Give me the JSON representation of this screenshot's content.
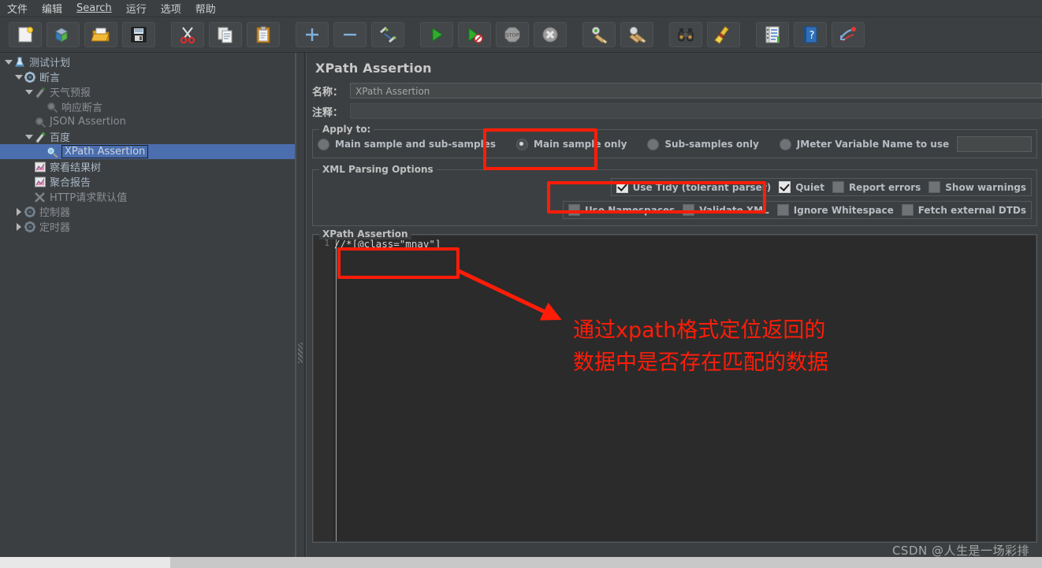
{
  "window": {
    "app": "Apache JMeter"
  },
  "menubar": {
    "items": [
      {
        "label": "文件",
        "underlined": false
      },
      {
        "label": "编辑",
        "underlined": false
      },
      {
        "label": "Search",
        "underlined": true
      },
      {
        "label": "运行",
        "underlined": false
      },
      {
        "label": "选项",
        "underlined": false
      },
      {
        "label": "帮助",
        "underlined": false
      }
    ]
  },
  "toolbar": {
    "buttons": [
      {
        "name": "new-icon",
        "tip": "新建"
      },
      {
        "name": "templates-icon",
        "tip": "模板"
      },
      {
        "name": "open-icon",
        "tip": "打开"
      },
      {
        "name": "save-icon",
        "tip": "保存"
      },
      {
        "name": "cut-icon",
        "tip": "剪切"
      },
      {
        "name": "copy-icon",
        "tip": "复制"
      },
      {
        "name": "paste-icon",
        "tip": "粘贴"
      },
      {
        "name": "expand-all-icon",
        "tip": "展开"
      },
      {
        "name": "collapse-all-icon",
        "tip": "折叠"
      },
      {
        "name": "toggle-icon",
        "tip": "启用/禁用"
      },
      {
        "name": "start-icon",
        "tip": "启动"
      },
      {
        "name": "start-no-pause-icon",
        "tip": "无超时启动"
      },
      {
        "name": "stop-icon",
        "tip": "停止"
      },
      {
        "name": "shutdown-icon",
        "tip": "关闭"
      },
      {
        "name": "clear-icon",
        "tip": "清除"
      },
      {
        "name": "clear-all-icon",
        "tip": "清除全部"
      },
      {
        "name": "search-binoculars-icon",
        "tip": "查找"
      },
      {
        "name": "reset-search-icon",
        "tip": "重置查找"
      },
      {
        "name": "function-helper-icon",
        "tip": "函数助手"
      },
      {
        "name": "help-icon",
        "tip": "帮助"
      },
      {
        "name": "undo-redo-icon",
        "tip": "撤销"
      }
    ]
  },
  "tree": {
    "nodes": [
      {
        "label": "测试计划",
        "indent": 0,
        "twisty": "down",
        "icon": "test-plan-icon",
        "dim": false,
        "selected": false
      },
      {
        "label": "断言",
        "indent": 1,
        "twisty": "down",
        "icon": "thread-group-icon",
        "dim": false,
        "selected": false
      },
      {
        "label": "天气预报",
        "indent": 2,
        "twisty": "down",
        "icon": "http-sampler-icon",
        "dim": true,
        "selected": false
      },
      {
        "label": "响应断言",
        "indent": 3,
        "twisty": "none",
        "icon": "assertion-icon",
        "dim": true,
        "selected": false
      },
      {
        "label": "JSON Assertion",
        "indent": 2,
        "twisty": "none",
        "icon": "assertion-icon",
        "dim": true,
        "selected": false
      },
      {
        "label": "百度",
        "indent": 2,
        "twisty": "down",
        "icon": "http-sampler-icon",
        "dim": false,
        "selected": false
      },
      {
        "label": "XPath Assertion",
        "indent": 3,
        "twisty": "none",
        "icon": "xpath-assertion-icon",
        "dim": false,
        "selected": true
      },
      {
        "label": "察看结果树",
        "indent": 2,
        "twisty": "none",
        "icon": "view-results-tree-icon",
        "dim": false,
        "selected": false
      },
      {
        "label": "聚合报告",
        "indent": 2,
        "twisty": "none",
        "icon": "aggregate-report-icon",
        "dim": false,
        "selected": false
      },
      {
        "label": "HTTP请求默认值",
        "indent": 2,
        "twisty": "none",
        "icon": "http-defaults-icon",
        "dim": true,
        "selected": false
      },
      {
        "label": "控制器",
        "indent": 1,
        "twisty": "right",
        "icon": "thread-group-icon",
        "dim": true,
        "selected": false
      },
      {
        "label": "定时器",
        "indent": 1,
        "twisty": "right",
        "icon": "thread-group-icon",
        "dim": true,
        "selected": false
      }
    ]
  },
  "main": {
    "title": "XPath Assertion",
    "name_label": "名称：",
    "name_value": "XPath Assertion",
    "comment_label": "注释：",
    "comment_value": "",
    "apply_to": {
      "legend": "Apply to:",
      "options": [
        {
          "label": "Main sample and sub-samples",
          "selected": false
        },
        {
          "label": "Main sample only",
          "selected": true
        },
        {
          "label": "Sub-samples only",
          "selected": false
        },
        {
          "label": "JMeter Variable Name to use",
          "selected": false
        }
      ],
      "variable_value": ""
    },
    "xml_parsing_options": {
      "legend": "XML Parsing Options",
      "row1": [
        {
          "label": "Use Tidy (tolerant parser)",
          "checked": true
        },
        {
          "label": "Quiet",
          "checked": true
        },
        {
          "label": "Report errors",
          "checked": false
        },
        {
          "label": "Show warnings",
          "checked": false
        }
      ],
      "row2": [
        {
          "label": "Use Namespaces",
          "checked": false
        },
        {
          "label": "Validate XML",
          "checked": false
        },
        {
          "label": "Ignore Whitespace",
          "checked": false
        },
        {
          "label": "Fetch external DTDs",
          "checked": false
        }
      ]
    },
    "xpath_assertion": {
      "legend": "XPath Assertion",
      "line_number": "1",
      "expression": "//*[@class=\"mnav\"]"
    }
  },
  "annotations": {
    "highlight_color": "#ff1d08",
    "text_lines": [
      "通过xpath格式定位返回的",
      "数据中是否存在匹配的数据"
    ],
    "boxes": [
      {
        "name": "main-sample-only-highlight"
      },
      {
        "name": "use-tidy-quiet-highlight"
      },
      {
        "name": "xpath-expression-highlight"
      }
    ]
  },
  "watermark": {
    "text": "CSDN @人生是一场彩排"
  }
}
